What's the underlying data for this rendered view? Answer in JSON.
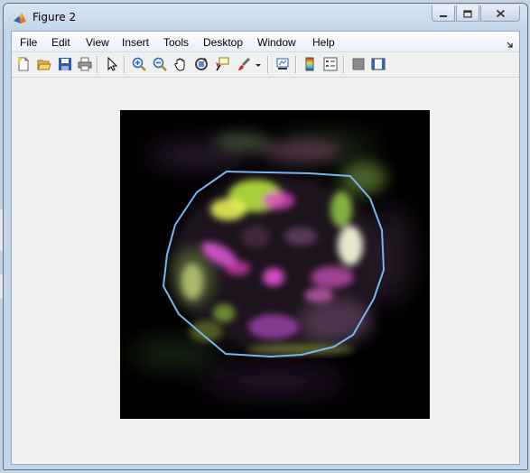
{
  "window": {
    "title": "Figure 2",
    "icon": "matlab-icon",
    "controls": [
      "minimize-icon",
      "maximize-icon",
      "close-icon"
    ]
  },
  "menu": {
    "items": [
      "File",
      "Edit",
      "View",
      "Insert",
      "Tools",
      "Desktop",
      "Window",
      "Help"
    ],
    "dock_icon": "dock-arrow-icon"
  },
  "toolbar": {
    "icons": [
      "new-figure-icon",
      "open-file-icon",
      "save-icon",
      "print-icon",
      "select-arrow-icon",
      "zoom-in-icon",
      "zoom-out-icon",
      "pan-hand-icon",
      "rotate-3d-icon",
      "data-cursor-icon",
      "brush-icon",
      "brush-dropdown-icon",
      "link-plot-icon",
      "colorbar-icon",
      "legend-icon",
      "hide-plot-tools-icon",
      "show-plot-tools-icon"
    ]
  },
  "figure": {
    "image": "color fluorescence image with outlined region",
    "outline_color": "#74b7ee",
    "background": "#000000"
  },
  "colors": {
    "titlebar": "#c5d6ea",
    "client": "#f0f0f0",
    "outline": "#74b7ee"
  }
}
